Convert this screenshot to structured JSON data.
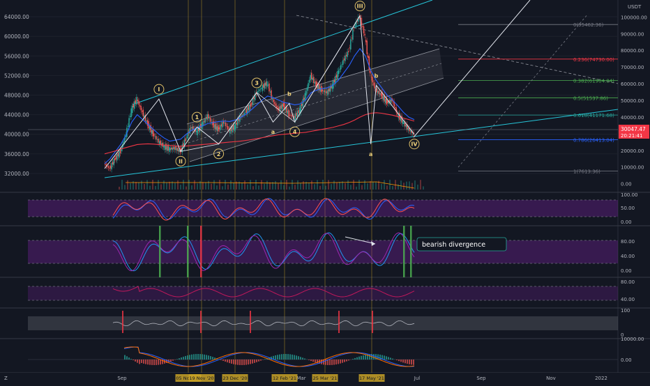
{
  "chart_data": {
    "type": "line",
    "title": "",
    "symbol_currency": "USDT",
    "price_axis_left": {
      "ticks": [
        64000,
        60000,
        56000,
        52000,
        48000,
        44000,
        40000,
        36000,
        32000
      ],
      "labels": [
        "64000.00",
        "60000.00",
        "56000.00",
        "52000.00",
        "48000.00",
        "44000.00",
        "40000.00",
        "36000.00",
        "32000.00"
      ],
      "ylim": [
        30000,
        66000
      ]
    },
    "price_axis_right": {
      "ticks": [
        100000,
        90000,
        80000,
        70000,
        60000,
        50000,
        40000,
        30000,
        20000,
        10000,
        0
      ],
      "labels": [
        "100000.00",
        "90000.00",
        "80000.00",
        "70000.00",
        "60000.00",
        "50000.00",
        "40000.00",
        "30000.00",
        "20000.00",
        "10000.00",
        "0.00"
      ],
      "ylim": [
        -1000,
        106000
      ]
    },
    "current_price": {
      "label": "30047.47",
      "countdown": "20:21:41",
      "value": 30047.47
    },
    "x_axis": {
      "labels": [
        "Sep",
        "Mar",
        "Jul",
        "Sep",
        "Nov",
        "2022"
      ],
      "label_pos": [
        0.0,
        0.4,
        0.64,
        0.79,
        0.95,
        1.1
      ],
      "date_markers": [
        "05 Nov '20",
        "19 Nov '20",
        "23 Dec '20",
        "12 Feb '21",
        "25 Mar '21",
        "17 May '21"
      ]
    },
    "series": [
      {
        "values": [
          34000,
          33000,
          35000,
          36500,
          40000,
          45000,
          47200,
          44500,
          42000,
          40000,
          38500,
          37500,
          37000,
          37200,
          36500,
          39000,
          41500,
          40500,
          42000,
          43800,
          42000,
          41000,
          42500,
          40800,
          41500,
          43500,
          44500,
          46000,
          48500,
          49500,
          50500,
          47000,
          45000,
          46000,
          44000,
          43500,
          45000,
          48000,
          52000,
          50000,
          49000,
          48500,
          50000,
          52500,
          55000,
          57000,
          62000,
          64200,
          60000,
          52000,
          49000,
          48000,
          46500,
          47000,
          44000,
          42500,
          41000,
          40000
        ]
      },
      {
        "values": [
          34000,
          35000,
          36500,
          38000,
          40000,
          42500,
          44000,
          43000,
          42000,
          41000,
          40000,
          39200,
          38600,
          38800,
          39000,
          40000,
          40800,
          41300,
          41700,
          42200,
          42400,
          42600,
          42700,
          42600,
          42900,
          43400,
          44100,
          45000,
          46000,
          47000,
          47800,
          47500,
          47000,
          46500,
          46300,
          46000,
          46200,
          47000,
          48500,
          49000,
          49300,
          49500,
          50000,
          51000,
          52500,
          54000,
          56000,
          57500,
          56000,
          53000,
          51000,
          49500,
          48000,
          47000,
          45800,
          44500,
          43500,
          43000
        ]
      },
      {
        "values": [
          36000,
          36300,
          36600,
          37000,
          37300,
          37600,
          37900,
          38000,
          38050,
          38000,
          37900,
          37800,
          37700,
          37600,
          37550,
          37600,
          37700,
          37800,
          37900,
          38000,
          38100,
          38200,
          38300,
          38400,
          38500,
          38600,
          38750,
          38900,
          39100,
          39300,
          39500,
          39700,
          39900,
          40000,
          40100,
          40200,
          40300,
          40400,
          40600,
          40800,
          41000,
          41200,
          41400,
          41700,
          42000,
          42400,
          42900,
          43500,
          44000,
          44300,
          44400,
          44300,
          44100,
          43900,
          43600,
          43300,
          43000,
          42700
        ]
      }
    ],
    "fib_levels": [
      {
        "ratio": "0",
        "label": "0(95462.36)",
        "value": 95462.36,
        "color": "#787b86"
      },
      {
        "ratio": "0.236",
        "label": "0.236(74730.00)",
        "value": 74730.0,
        "color": "#f23645"
      },
      {
        "ratio": "0.382",
        "label": "0.382(61904.04)",
        "value": 61904.04,
        "color": "#4caf50"
      },
      {
        "ratio": "0.5",
        "label": "0.5(51537.86)",
        "value": 51537.86,
        "color": "#4caf50"
      },
      {
        "ratio": "0.618",
        "label": "0.618(41171.68)",
        "value": 41171.68,
        "color": "#26a69a"
      },
      {
        "ratio": "0.786",
        "label": "0.786(26413.04)",
        "value": 26413.04,
        "color": "#2962ff"
      },
      {
        "ratio": "1",
        "label": "1(7613.36)",
        "value": 7613.36,
        "color": "#787b86"
      }
    ],
    "wave_labels": [
      {
        "text": "I",
        "idx": 10,
        "price": 47200
      },
      {
        "text": "II",
        "idx": 14,
        "price": 36500
      },
      {
        "text": "1",
        "idx": 17,
        "price": 41500
      },
      {
        "text": "2",
        "idx": 21,
        "price": 38000
      },
      {
        "text": "3",
        "idx": 28,
        "price": 48500
      },
      {
        "text": "a",
        "idx": 31,
        "price": 42500
      },
      {
        "text": "b",
        "idx": 34,
        "price": 46300
      },
      {
        "text": "4",
        "idx": 35,
        "price": 42500
      },
      {
        "text": "III",
        "idx": 47,
        "price": 64200
      },
      {
        "text": "b",
        "idx": 50,
        "price": 50000
      },
      {
        "text": "a",
        "idx": 49,
        "price": 38000
      },
      {
        "text": "IV",
        "idx": 57,
        "price": 40000
      }
    ],
    "panes": [
      {
        "name": "stoch_rsi_1",
        "ticks": [
          "100.00",
          "50.00",
          "0.00"
        ]
      },
      {
        "name": "stoch_rsi_2",
        "ticks": [
          "80.00",
          "40.00",
          "0.00"
        ],
        "annotation": "bearish divergence"
      },
      {
        "name": "rsi",
        "ticks": [
          "80.00",
          "40.00"
        ]
      },
      {
        "name": "oscillator",
        "ticks": [
          "100",
          "0"
        ]
      },
      {
        "name": "macd",
        "ticks": [
          "10000.00",
          "0.00"
        ]
      }
    ]
  }
}
